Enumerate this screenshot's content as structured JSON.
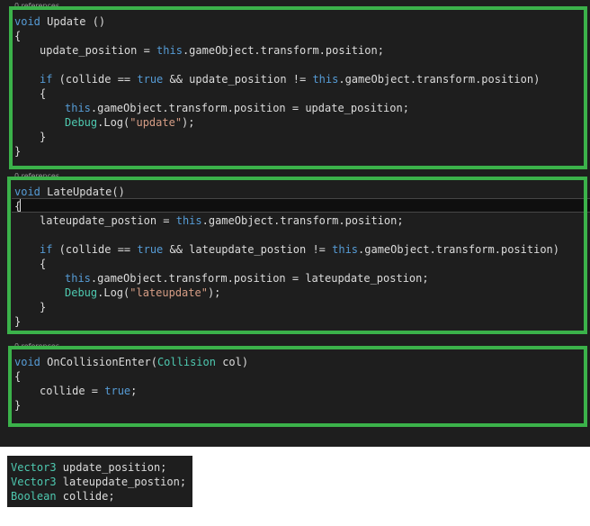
{
  "colors": {
    "editor_bg": "#1e1e1e",
    "highlight_frame": "#3bb24a",
    "keyword": "#569cd6",
    "string": "#d69d85",
    "type": "#4ec9b0",
    "text": "#dcdcdc"
  },
  "update_block": {
    "codelens": "0 references",
    "kw_void": "void",
    "signature": " Update ()",
    "open_brace": "{",
    "assign": "update_position = ",
    "this_kw": "this",
    "assign_rhs": ".gameObject.transform.position;",
    "if_kw": "if",
    "cond_a": " (collide == ",
    "true_kw": "true",
    "cond_b": " && update_position != ",
    "cond_c": ".gameObject.transform.position)",
    "inner_open": "{",
    "stmt_rhs": ".gameObject.transform.position = update_position;",
    "debug_type": "Debug",
    "log_call": ".Log(",
    "log_str": "\"update\"",
    "log_end": ");",
    "inner_close": "}",
    "close_brace": "}"
  },
  "late_block": {
    "codelens": "0 references",
    "kw_void": "void",
    "signature": " LateUpdate()",
    "open_brace": "{",
    "assign": "lateupdate_postion = ",
    "this_kw": "this",
    "assign_rhs": ".gameObject.transform.position;",
    "if_kw": "if",
    "cond_a": " (collide == ",
    "true_kw": "true",
    "cond_b": " && lateupdate_postion != ",
    "cond_c": ".gameObject.transform.position)",
    "inner_open": "{",
    "stmt_rhs": ".gameObject.transform.position = lateupdate_postion;",
    "debug_type": "Debug",
    "log_call": ".Log(",
    "log_str": "\"lateupdate\"",
    "log_end": ");",
    "inner_close": "}",
    "close_brace": "}"
  },
  "collision_block": {
    "codelens": "0 references",
    "kw_void": "void",
    "sig_a": " OnCollisionEnter(",
    "param_type": "Collision",
    "sig_b": " col)",
    "open_brace": "{",
    "assign": "collide = ",
    "true_kw": "true",
    "semi": ";",
    "close_brace": "}"
  },
  "declarations": [
    {
      "type": "Vector3",
      "rest": " update_position;"
    },
    {
      "type": "Vector3",
      "rest": " lateupdate_postion;"
    },
    {
      "type": "Boolean",
      "rest": " collide;"
    }
  ]
}
